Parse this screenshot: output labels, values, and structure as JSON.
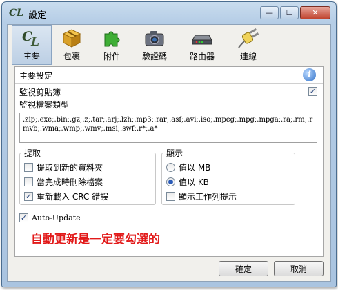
{
  "window": {
    "title": "設定",
    "app_icon_text": "CL",
    "minimize_glyph": "—",
    "maximize_glyph": "☐",
    "close_glyph": "✕"
  },
  "toolbar": {
    "items": [
      {
        "label": "主要",
        "icon": "cl-logo-icon",
        "active": true
      },
      {
        "label": "包裹",
        "icon": "package-box-icon",
        "active": false
      },
      {
        "label": "附件",
        "icon": "puzzle-piece-icon",
        "active": false
      },
      {
        "label": "驗證碼",
        "icon": "camera-icon",
        "active": false
      },
      {
        "label": "路由器",
        "icon": "router-icon",
        "active": false
      },
      {
        "label": "連線",
        "icon": "plug-icon",
        "active": false
      }
    ]
  },
  "panel": {
    "title": "主要設定",
    "info_glyph": "i",
    "clipboard": {
      "label": "監視剪貼簿",
      "checked": true
    },
    "file_types": {
      "label": "監視檔案類型",
      "value": ".zip;.exe;.bin;.gz;.z;.tar;.arj;.lzh;.mp3;.rar;.asf;.avi;.iso;.mpeg;.mpg;.mpga;.ra;.rm;.rmvb;.wma;.wmp;.wmv;.msi;.swf;.r*;.a*"
    },
    "extract": {
      "title": "提取",
      "options": [
        {
          "label": "提取到新的資料夾",
          "checked": false
        },
        {
          "label": "當完成時刪除檔案",
          "checked": false
        },
        {
          "label": "重新載入 CRC 錯誤",
          "checked": true
        }
      ]
    },
    "display": {
      "title": "顯示",
      "options": [
        {
          "label": "值以 MB",
          "type": "radio",
          "checked": false
        },
        {
          "label": "值以 KB",
          "type": "radio",
          "checked": true
        },
        {
          "label": "顯示工作列提示",
          "type": "checkbox",
          "checked": false
        }
      ]
    },
    "auto_update": {
      "label": "Auto-Update",
      "checked": true
    },
    "annotation": "自動更新是一定要勾選的"
  },
  "buttons": {
    "ok": "確定",
    "cancel": "取消"
  },
  "colors": {
    "annotation": "#e21a1a",
    "check": "#1f3f7a",
    "active_tab": "#bccfe4"
  }
}
